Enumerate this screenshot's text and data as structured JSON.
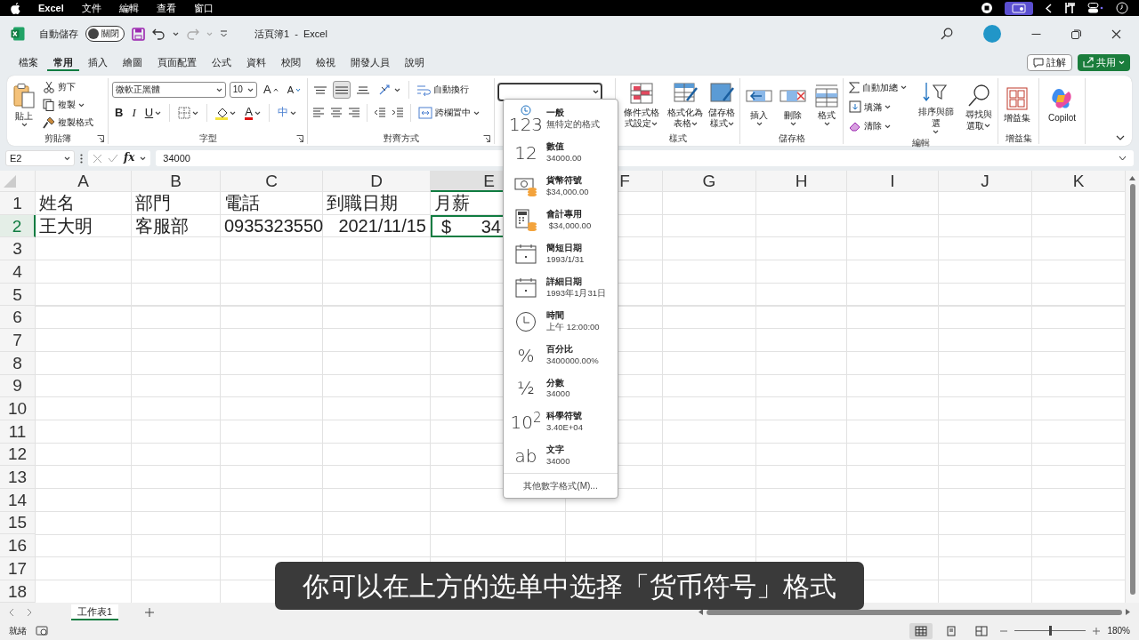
{
  "menu_bar": {
    "items": [
      "Excel",
      "文件",
      "編輯",
      "查看",
      "窗口"
    ]
  },
  "title_bar": {
    "autosave_label": "自動儲存",
    "autosave_toggle": {
      "label": "關閉",
      "on": false
    },
    "redo": {
      "disabled": true
    },
    "title": "活頁簿1  -  Excel"
  },
  "ribbon_tabs": [
    {
      "label": "檔案",
      "selected": false
    },
    {
      "label": "常用",
      "selected": true
    },
    {
      "label": "插入",
      "selected": false
    },
    {
      "label": "繪圖",
      "selected": false
    },
    {
      "label": "頁面配置",
      "selected": false
    },
    {
      "label": "公式",
      "selected": false
    },
    {
      "label": "資料",
      "selected": false
    },
    {
      "label": "校閱",
      "selected": false
    },
    {
      "label": "檢視",
      "selected": false
    },
    {
      "label": "開發人員",
      "selected": false
    },
    {
      "label": "說明",
      "selected": false
    }
  ],
  "ribbon_actions": {
    "comments": "註解",
    "share": "共用"
  },
  "ribbon": {
    "clipboard": {
      "label": "剪貼簿",
      "paste": "貼上",
      "cut": "剪下",
      "copy": "複製",
      "format_painter": "複製格式"
    },
    "font": {
      "label": "字型",
      "font_name": "微軟正黑體",
      "font_size": "10",
      "grow": "A",
      "shrink": "A",
      "bold": "B",
      "italic": "I",
      "underline": "U",
      "font_color": "A",
      "phonetic": "中"
    },
    "alignment": {
      "label": "對齊方式",
      "vertical": [
        {
          "selected": false
        },
        {
          "selected": true
        },
        {
          "selected": false
        }
      ],
      "wrap_text": "自動換行",
      "merge_center": "跨欄置中"
    },
    "number": {
      "expanded": true
    },
    "styles": {
      "label": "樣式",
      "buttons": [
        "條件式格式設定",
        "格式化為表格",
        "儲存格樣式"
      ]
    },
    "cells": {
      "label": "儲存格",
      "buttons": [
        "插入",
        "刪除",
        "格式"
      ]
    },
    "editing": {
      "label": "編輯",
      "autosum": "自動加總",
      "fill": "填滿",
      "clear": "清除",
      "sort_filter": "排序與篩選",
      "find_select": "尋找與選取"
    },
    "addins": {
      "label": "增益集",
      "button": "增益集"
    },
    "copilot": {
      "button": "Copilot"
    }
  },
  "formula_bar": {
    "name_box": "E2",
    "confirm_disabled": true,
    "function_label": "fx",
    "formula": "34000"
  },
  "sheet": {
    "columns": [
      {
        "label": "A",
        "selected": false
      },
      {
        "label": "B",
        "selected": false
      },
      {
        "label": "C",
        "selected": false
      },
      {
        "label": "D",
        "selected": false
      },
      {
        "label": "E",
        "selected": true
      },
      {
        "label": "F",
        "selected": false
      },
      {
        "label": "G",
        "selected": false
      },
      {
        "label": "H",
        "selected": false
      },
      {
        "label": "I",
        "selected": false
      },
      {
        "label": "J",
        "selected": false
      },
      {
        "label": "K",
        "selected": false
      }
    ],
    "rows": [
      {
        "label": "1",
        "selected": false,
        "cells": [
          {
            "kind": "text",
            "text": "姓名",
            "selected": false
          },
          {
            "kind": "text",
            "text": "部門",
            "selected": false
          },
          {
            "kind": "text",
            "text": "電話",
            "selected": false
          },
          {
            "kind": "text",
            "text": "到職日期",
            "selected": false
          },
          {
            "kind": "text",
            "text": "月薪",
            "selected": false
          }
        ]
      },
      {
        "label": "2",
        "selected": true,
        "cells": [
          {
            "kind": "text",
            "text": "王大明",
            "selected": false
          },
          {
            "kind": "text",
            "text": "客服部",
            "selected": false
          },
          {
            "kind": "text",
            "text": "0935323550",
            "selected": false
          },
          {
            "kind": "date",
            "text": "2021/11/15",
            "selected": false
          },
          {
            "kind": "currency",
            "symbol": "$",
            "text": "34",
            "selected": true
          }
        ]
      },
      {
        "label": "3",
        "selected": false
      },
      {
        "label": "4",
        "selected": false
      },
      {
        "label": "5",
        "selected": false
      },
      {
        "label": "6",
        "selected": false
      },
      {
        "label": "7",
        "selected": false
      },
      {
        "label": "8",
        "selected": false
      },
      {
        "label": "9",
        "selected": false
      },
      {
        "label": "10",
        "selected": false
      },
      {
        "label": "11",
        "selected": false
      },
      {
        "label": "12",
        "selected": false
      },
      {
        "label": "13",
        "selected": false
      },
      {
        "label": "14",
        "selected": false
      },
      {
        "label": "15",
        "selected": false
      },
      {
        "label": "16",
        "selected": false
      },
      {
        "label": "17",
        "selected": false
      },
      {
        "label": "18",
        "selected": false
      }
    ]
  },
  "number_format_menu": {
    "items": [
      {
        "kind": "general",
        "glyph": "123",
        "title": "一般",
        "example": "無特定的格式"
      },
      {
        "kind": "number",
        "glyph": "12",
        "title": "數值",
        "example": "34000.00"
      },
      {
        "kind": "currency",
        "title": "貨幣符號",
        "example": "$34,000.00"
      },
      {
        "kind": "accounting",
        "title": "會計專用",
        "example": " $34,000.00"
      },
      {
        "kind": "short_date",
        "title": "簡短日期",
        "example": "1993/1/31"
      },
      {
        "kind": "long_date",
        "title": "詳細日期",
        "example": "1993年1月31日"
      },
      {
        "kind": "time",
        "title": "時間",
        "example": "上午 12:00:00"
      },
      {
        "kind": "percentage",
        "glyph": "%",
        "title": "百分比",
        "example": "3400000.00%"
      },
      {
        "kind": "fraction",
        "glyph": "½",
        "title": "分數",
        "example": "34000"
      },
      {
        "kind": "scientific",
        "glyph": "10$^{2}$",
        "title": "科學符號",
        "example": "3.40E+04"
      },
      {
        "kind": "text",
        "glyph": "ab",
        "title": "文字",
        "example": "34000"
      }
    ],
    "footer": "其他數字格式(M)..."
  },
  "sheet_tabs": [
    {
      "label": "工作表1",
      "selected": true
    }
  ],
  "status_bar": {
    "status": "就緒",
    "views": [
      {
        "selected": true
      },
      {
        "selected": false
      },
      {
        "selected": false
      }
    ],
    "zoom": {
      "level": 0.5
    },
    "zoom_label": "180%"
  },
  "caption": "你可以在上方的选单中选择「货币符号」格式"
}
